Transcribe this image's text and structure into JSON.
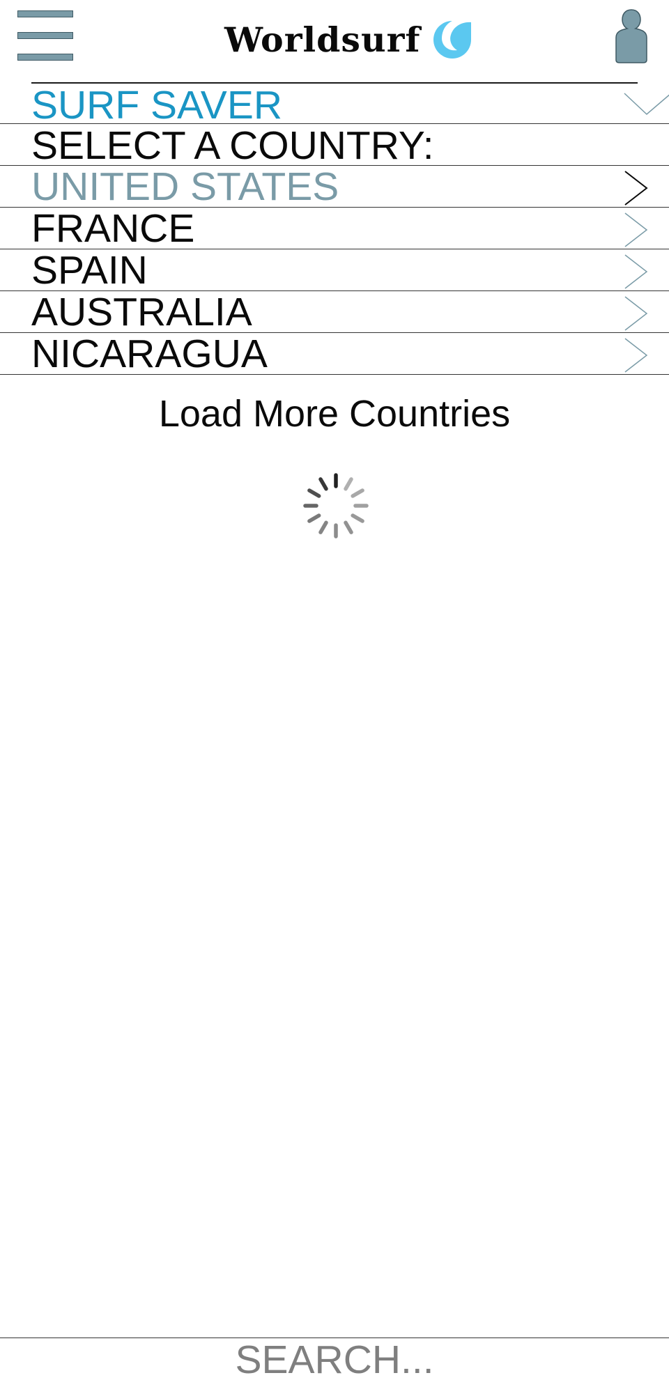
{
  "app": {
    "brand": "Worldsurf"
  },
  "icons": {
    "menu": "hamburger-menu-icon",
    "logo_mark": "wave-icon",
    "user": "user-profile-icon",
    "section_toggle": "chevron-down-icon",
    "row_arrow": "chevron-right-icon",
    "loading": "loading-spinner-icon"
  },
  "colors": {
    "accent_blue": "#1a95c4",
    "slate": "#7a9ba7",
    "logo_wave": "#5bc8f0",
    "text": "#0a0a0a",
    "placeholder": "#7f7f7f"
  },
  "section": {
    "title": "SURF SAVER",
    "prompt": "SELECT A COUNTRY:"
  },
  "countries": [
    {
      "label": "UNITED STATES",
      "selected": true
    },
    {
      "label": "FRANCE",
      "selected": false
    },
    {
      "label": "SPAIN",
      "selected": false
    },
    {
      "label": "AUSTRALIA",
      "selected": false
    },
    {
      "label": "NICARAGUA",
      "selected": false
    }
  ],
  "load_more": {
    "label": "Load More Countries"
  },
  "search": {
    "placeholder": "SEARCH...",
    "value": ""
  }
}
